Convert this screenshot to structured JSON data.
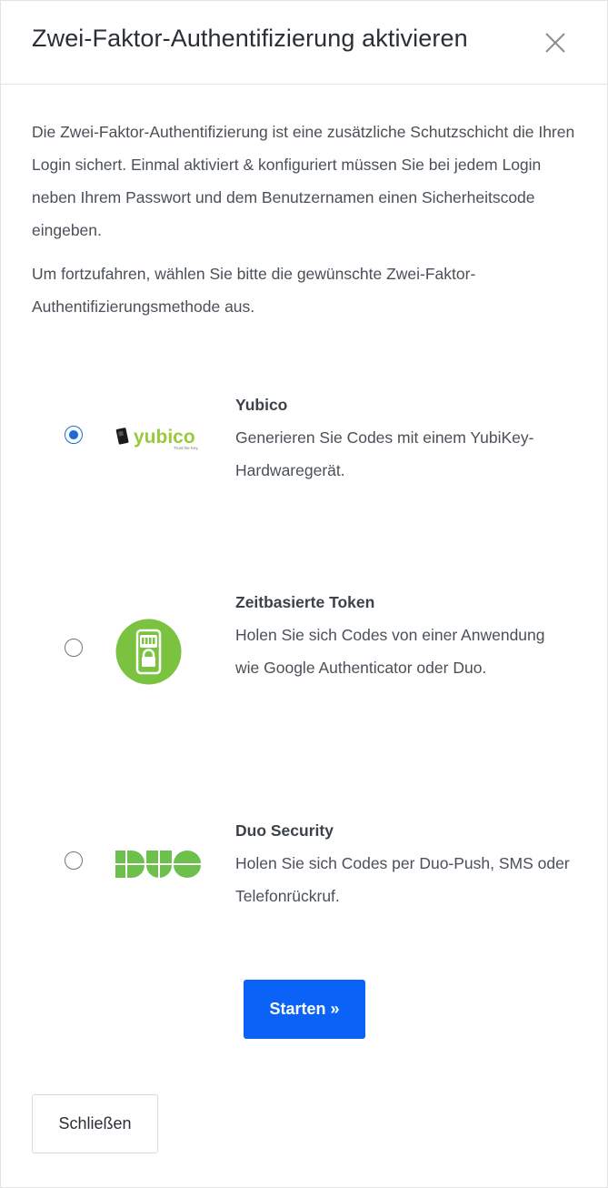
{
  "modal": {
    "title": "Zwei-Faktor-Authentifizierung aktivieren",
    "intro_1": "Die Zwei-Faktor-Authentifizierung ist eine zusätzliche Schutzschicht die Ihren Login sichert. Einmal aktiviert & konfiguriert müssen Sie bei jedem Login neben Ihrem Passwort und dem Benutzernamen einen Sicherheitscode eingeben.",
    "intro_2": "Um fortzufahren, wählen Sie bitte die gewünschte Zwei-Faktor-Authentifizierungsmethode aus."
  },
  "options": [
    {
      "title": "Yubico",
      "description": "Generieren Sie Codes mit einem YubiKey-Hardwaregerät.",
      "logo_text": "yubico",
      "logo_tagline": "Trust the Key.",
      "selected": true
    },
    {
      "title": "Zeitbasierte Token",
      "description": "Holen Sie sich Codes von einer Anwendung wie Google Authenticator oder Duo.",
      "selected": false
    },
    {
      "title": "Duo Security",
      "description": "Holen Sie sich Codes per Duo-Push, SMS oder Telefonrückruf.",
      "selected": false
    }
  ],
  "buttons": {
    "start": "Starten »",
    "close": "Schließen"
  },
  "colors": {
    "primary": "#0b62f7",
    "radio_checked": "#1a6ad8",
    "yubico_green": "#9aca3c",
    "totp_green": "#7cc241",
    "duo_green": "#6dc04b"
  },
  "icons": {
    "close": "close-icon",
    "yubico": "yubico-logo",
    "totp": "phone-lock-icon",
    "duo": "duo-logo"
  }
}
